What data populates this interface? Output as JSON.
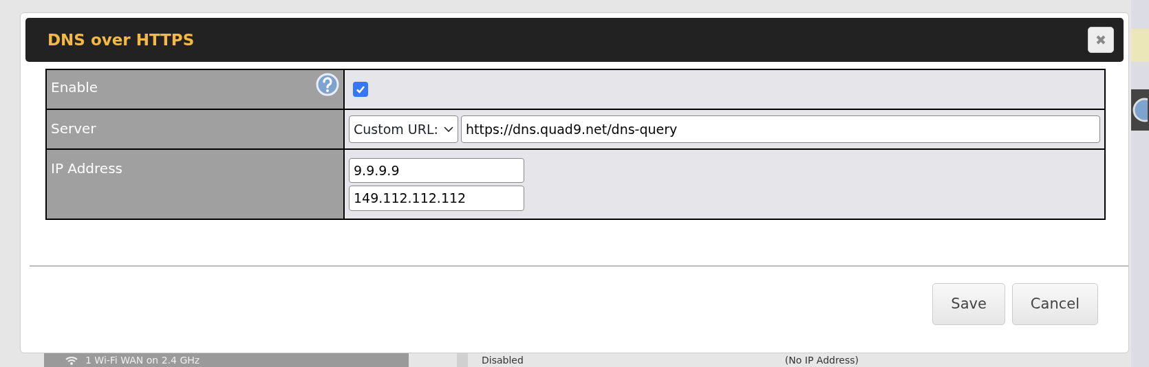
{
  "dialog": {
    "title": "DNS over HTTPS",
    "rows": [
      {
        "kind": "checkbox",
        "label": "Enable",
        "help": true,
        "checked": true
      },
      {
        "kind": "server",
        "label": "Server",
        "help": false,
        "select": "Custom URL:",
        "value": "https://dns.quad9.net/dns-query"
      },
      {
        "kind": "ips",
        "label": "IP Address",
        "help": false,
        "values": [
          "9.9.9.9",
          "149.112.112.112"
        ]
      }
    ],
    "buttons": [
      "Save",
      "Cancel"
    ]
  },
  "background_row": {
    "name": "1 Wi-Fi WAN on 2.4 GHz",
    "status": "Disabled",
    "ip": "(No IP Address)"
  }
}
